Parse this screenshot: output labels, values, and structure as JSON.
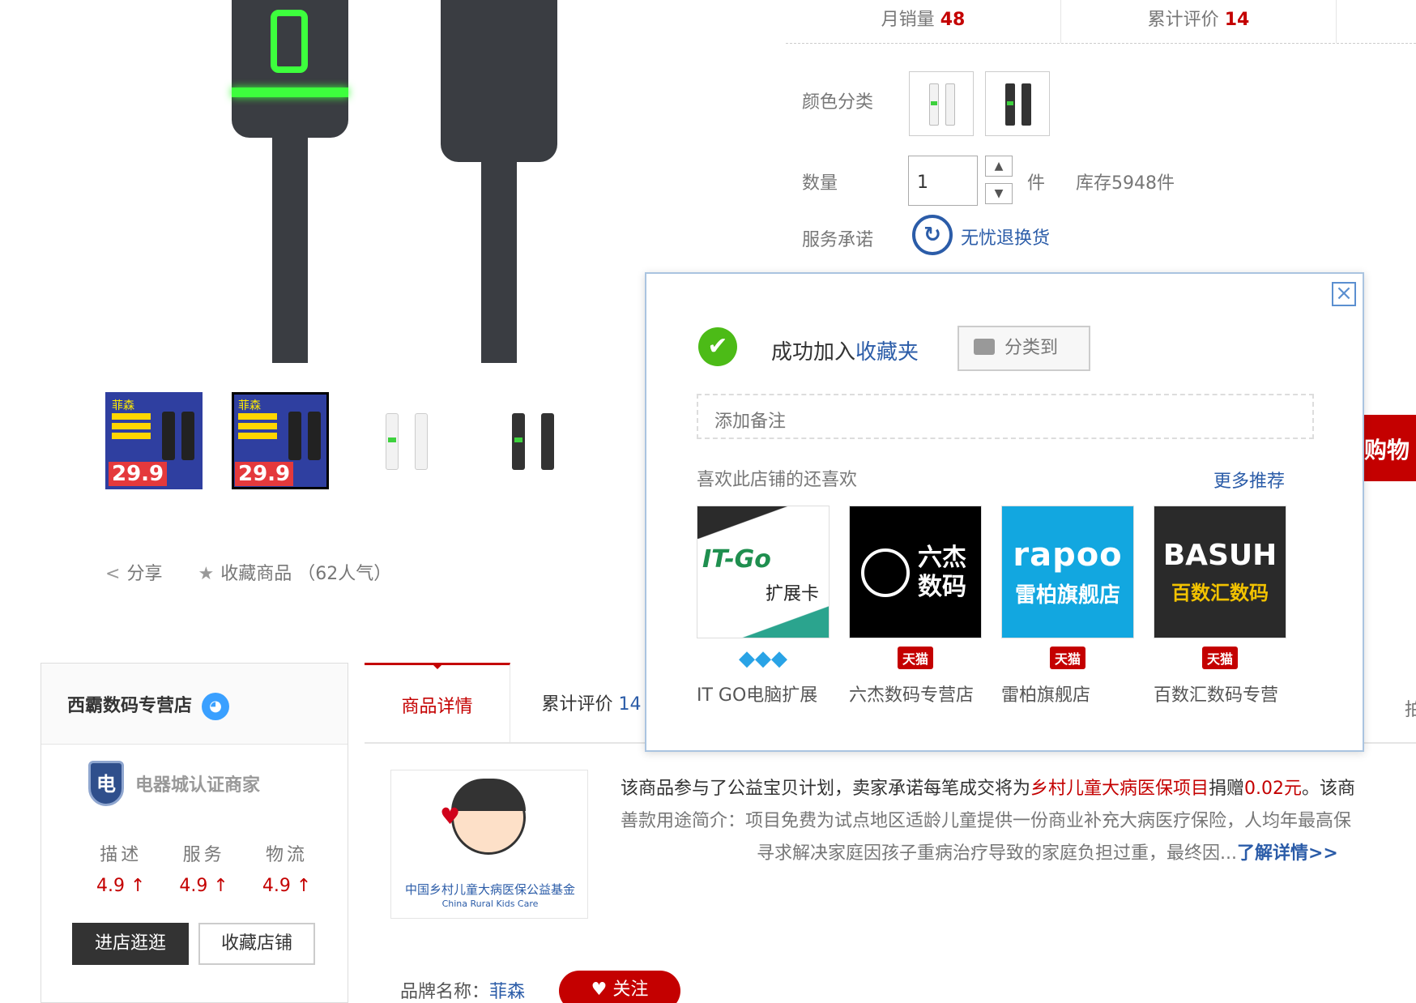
{
  "stats": {
    "monthly_sales_label": "月销量",
    "monthly_sales_value": "48",
    "total_reviews_label": "累计评价",
    "total_reviews_value": "14"
  },
  "spec": {
    "color_label": "颜色分类",
    "quantity_label": "数量",
    "quantity_value": "1",
    "quantity_unit": "件",
    "stock_text": "库存5948件",
    "service_label": "服务承诺",
    "service_text": "无忧退换货"
  },
  "buy_button": "购物",
  "thumbnails": [
    {
      "brand": "菲森",
      "price": "29.9"
    },
    {
      "brand": "菲森",
      "price": "29.9"
    }
  ],
  "actions": {
    "share": "分享",
    "favorite": "收藏商品",
    "favorite_count": "（62人气）"
  },
  "shop": {
    "name": "西霸数码专营店",
    "cert_badge": "电",
    "cert_label": "电器城认证商家",
    "scores": [
      {
        "label": "描述",
        "value": "4.9 ↑"
      },
      {
        "label": "服务",
        "value": "4.9 ↑"
      },
      {
        "label": "物流",
        "value": "4.9 ↑"
      }
    ],
    "enter_button": "进店逛逛",
    "favorite_button": "收藏店铺"
  },
  "tabs": {
    "details": "商品详情",
    "reviews": "累计评价",
    "reviews_count": "14",
    "overflow": "拍"
  },
  "charity": {
    "logo_cn": "中国乡村儿童大病医保公益基金",
    "logo_en": "China Rural Kids Care",
    "line1_a": "该商品参与了公益宝贝计划，卖家承诺每笔成交将为",
    "line1_project": "乡村儿童大病医保项目",
    "line1_b": "捐赠",
    "line1_amount": "0.02元",
    "line1_c": "。该商",
    "line2": "善款用途简介：项目免费为试点地区适龄儿童提供一份商业补充大病医疗保险，人均年最高保",
    "line3": "寻求解决家庭因孩子重病治疗导致的家庭负担过重，最终因...",
    "line3_link": "了解详情>>"
  },
  "brand": {
    "label": "品牌名称：",
    "name": "菲森",
    "follow": "关注"
  },
  "popup": {
    "success_prefix": "成功加入",
    "success_link": "收藏夹",
    "classify_button": "分类到",
    "note_placeholder": "添加备注",
    "rec_title": "喜欢此店铺的还喜欢",
    "rec_more": "更多推荐",
    "close_icon": "close-icon",
    "items": [
      {
        "name": "IT GO电脑扩展",
        "logo_text": "IT-Go",
        "logo_sub": "扩展卡",
        "badge": "diamond"
      },
      {
        "name": "六杰数码专营店",
        "logo_text": "六杰",
        "logo_sub": "数码",
        "badge": "天猫"
      },
      {
        "name": "雷柏旗舰店",
        "logo_text": "rapoo",
        "logo_sub": "雷柏旗舰店",
        "badge": "天猫"
      },
      {
        "name": "百数汇数码专营",
        "logo_text": "BASUH",
        "logo_sub": "百数汇数码",
        "badge": "天猫"
      }
    ]
  },
  "colors": {
    "accent_red": "#c40000",
    "link_blue": "#2b5ca8",
    "tmall_red": "#c40000",
    "success_green": "#4cbb17"
  }
}
